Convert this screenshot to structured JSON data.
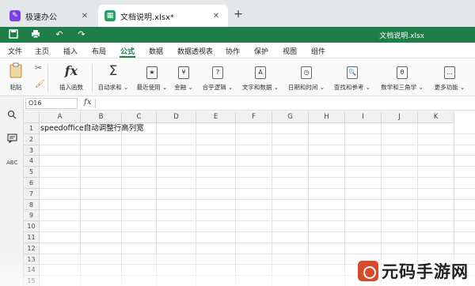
{
  "tabs": {
    "home": {
      "label": "极速办公",
      "close": "✕"
    },
    "doc": {
      "label": "文档说明.xlsx*",
      "close": "✕"
    },
    "new_tab": "+"
  },
  "quick_bar": {
    "title": "文档说明.xlsx",
    "icons": [
      "save-icon",
      "print-icon",
      "undo-icon",
      "redo-icon"
    ]
  },
  "menu": {
    "items": [
      "文件",
      "主页",
      "插入",
      "布局",
      "公式",
      "数据",
      "数据透视表",
      "协作",
      "保护",
      "视图",
      "组件"
    ],
    "active": "公式"
  },
  "ribbon": {
    "paste": "粘贴",
    "buttons": [
      {
        "label": "插入函数",
        "icon": "fx"
      },
      {
        "label": "自动求和 ⌄",
        "icon": "Σ"
      },
      {
        "label": "最近使用 ⌄",
        "icon": "★"
      },
      {
        "label": "金融 ⌄",
        "icon": "¥"
      },
      {
        "label": "合乎逻辑 ⌄",
        "icon": "?"
      },
      {
        "label": "文字和数据 ⌄",
        "icon": "A"
      },
      {
        "label": "日期和时间 ⌄",
        "icon": "◷"
      },
      {
        "label": "查找和参考 ⌄",
        "icon": "🔍"
      },
      {
        "label": "数学和三角学 ⌄",
        "icon": "θ"
      },
      {
        "label": "更多功能 ⌄",
        "icon": "…"
      }
    ]
  },
  "formula_bar": {
    "name_box": "O16",
    "fx": "fx",
    "value": ""
  },
  "grid": {
    "columns": [
      "A",
      "B",
      "C",
      "D",
      "E",
      "F",
      "G",
      "H",
      "I",
      "J",
      "K"
    ],
    "rows": [
      "1",
      "2",
      "3",
      "4",
      "5",
      "6",
      "7",
      "8",
      "9",
      "10",
      "11",
      "12",
      "13",
      "14",
      "15"
    ],
    "a1": "speedoffice自动调整行高列宽"
  },
  "watermark": {
    "text": "元码手游网"
  },
  "colors": {
    "accent": "#1e7d48",
    "tabbar": "#e4e7ea"
  }
}
